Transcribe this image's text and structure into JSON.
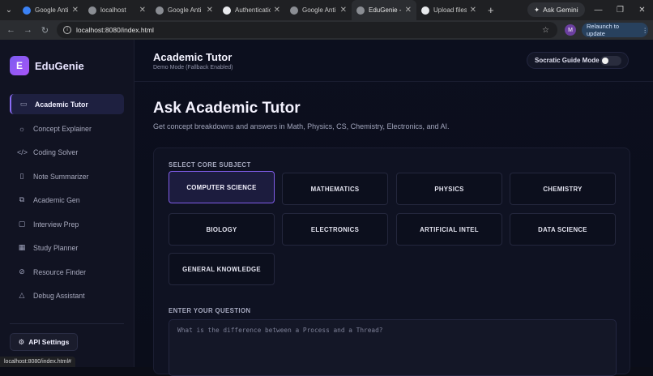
{
  "browser": {
    "tabs": [
      {
        "title": "Google Anti",
        "active": false
      },
      {
        "title": "localhost",
        "active": false
      },
      {
        "title": "Google Anti",
        "active": false
      },
      {
        "title": "Authenticatio",
        "active": false
      },
      {
        "title": "Google Anti",
        "active": false
      },
      {
        "title": "EduGenie - A",
        "active": true
      },
      {
        "title": "Upload files",
        "active": false
      }
    ],
    "ask_gemini": "Ask Gemini",
    "url": "localhost:8080/index.html",
    "profile_initial": "M",
    "relaunch_label": "Relaunch to update",
    "status_url": "localhost:8080/index.html#"
  },
  "sidebar": {
    "logo_letter": "E",
    "brand": "EduGenie",
    "items": [
      {
        "label": "Academic Tutor",
        "icon": "book-icon",
        "active": true
      },
      {
        "label": "Concept Explainer",
        "icon": "lightbulb-icon",
        "active": false
      },
      {
        "label": "Coding Solver",
        "icon": "code-icon",
        "active": false
      },
      {
        "label": "Note Summarizer",
        "icon": "document-icon",
        "active": false
      },
      {
        "label": "Academic Gen",
        "icon": "copy-icon",
        "active": false
      },
      {
        "label": "Interview Prep",
        "icon": "chat-icon",
        "active": false
      },
      {
        "label": "Study Planner",
        "icon": "calendar-icon",
        "active": false
      },
      {
        "label": "Resource Finder",
        "icon": "link-icon",
        "active": false
      },
      {
        "label": "Debug Assistant",
        "icon": "warning-icon",
        "active": false
      }
    ],
    "api_settings": "API Settings"
  },
  "header": {
    "title": "Academic Tutor",
    "subtitle": "Demo Mode (Fallback Enabled)",
    "socratic_label": "Socratic Guide Mode",
    "socratic_on": false
  },
  "main": {
    "heading": "Ask Academic Tutor",
    "description": "Get concept breakdowns and answers in Math, Physics, CS, Chemistry, Electronics, and AI.",
    "subject_label": "SELECT CORE SUBJECT",
    "subjects": [
      {
        "label": "COMPUTER SCIENCE",
        "selected": true
      },
      {
        "label": "MATHEMATICS",
        "selected": false
      },
      {
        "label": "PHYSICS",
        "selected": false
      },
      {
        "label": "CHEMISTRY",
        "selected": false
      },
      {
        "label": "BIOLOGY",
        "selected": false
      },
      {
        "label": "ELECTRONICS",
        "selected": false
      },
      {
        "label": "ARTIFICIAL INTEL",
        "selected": false
      },
      {
        "label": "DATA SCIENCE",
        "selected": false
      },
      {
        "label": "GENERAL KNOWLEDGE",
        "selected": false
      }
    ],
    "question_label": "ENTER YOUR QUESTION",
    "question_placeholder": "What is the difference between a Process and a Thread?"
  },
  "colors": {
    "accent": "#8b6cf6",
    "background": "#0b0d17",
    "sidebar": "#111322"
  }
}
